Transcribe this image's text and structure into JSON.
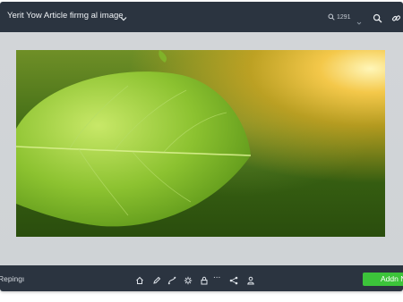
{
  "window": {
    "title": "Yerit Yow Article firmg al image",
    "zoom_label": "1291"
  },
  "image": {
    "subject": "green leaf close-up on blurred green background with warm sunlight"
  },
  "bottombar": {
    "status_text": "Repingı",
    "ellipsis": "...",
    "action_label": "Addn N"
  },
  "colors": {
    "bar_background": "#2b3440",
    "canvas_background": "#d2d5d8",
    "action_button": "#3cc43a"
  },
  "icons": [
    "chevron-down-icon",
    "zoom-icon",
    "search-icon",
    "link-icon",
    "home-icon",
    "pen-icon",
    "curve-icon",
    "gear-icon",
    "lock-icon",
    "share-icon",
    "user-icon"
  ]
}
